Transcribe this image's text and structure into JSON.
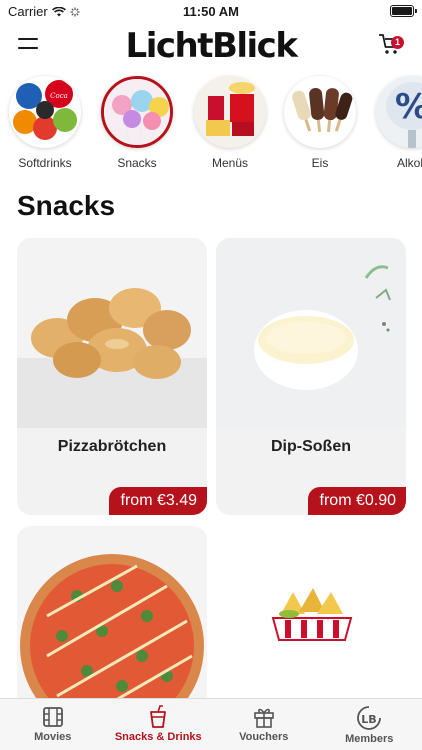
{
  "status_bar": {
    "carrier": "Carrier",
    "time": "11:50 AM"
  },
  "header": {
    "logo": "LichtBlick",
    "cart_count": "1",
    "icons": {
      "menu": "hamburger-menu-icon",
      "cart": "cart-icon"
    }
  },
  "categories": [
    {
      "label": "Softdrinks",
      "active": false
    },
    {
      "label": "Snacks",
      "active": true
    },
    {
      "label": "Menüs",
      "active": false
    },
    {
      "label": "Eis",
      "active": false
    },
    {
      "label": "Alkoh",
      "active": false
    }
  ],
  "section_title": "Snacks",
  "products": [
    {
      "name": "Pizzabrötchen",
      "price": "from €3.49"
    },
    {
      "name": "Dip-Soßen",
      "price": "from €0.90"
    },
    {
      "name": "",
      "price": ""
    },
    {
      "name": "",
      "price": ""
    }
  ],
  "tabbar": [
    {
      "label": "Movies",
      "icon": "film-icon",
      "active": false
    },
    {
      "label": "Snacks & Drinks",
      "icon": "cup-icon",
      "active": true
    },
    {
      "label": "Vouchers",
      "icon": "gift-icon",
      "active": false
    },
    {
      "label": "Members",
      "icon": "lb-members-icon",
      "active": false
    }
  ],
  "colors": {
    "accent": "#b5121b",
    "card_bg": "#f2f2f2",
    "badge": "#c8102e"
  }
}
